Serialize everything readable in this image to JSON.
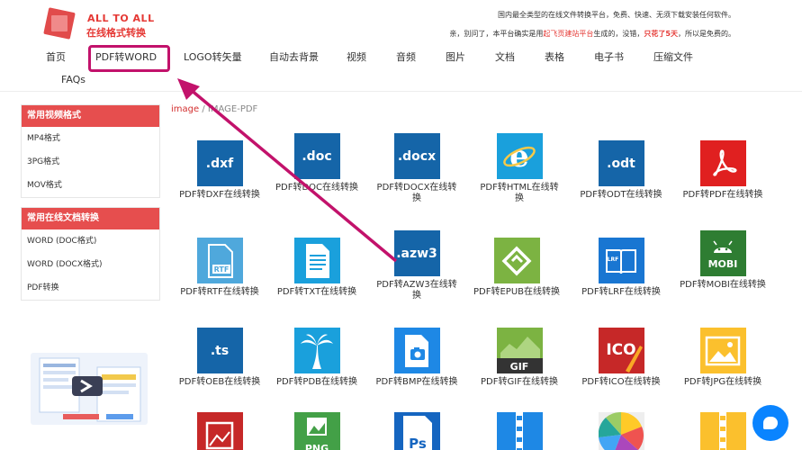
{
  "brand": {
    "line1": "ALL TO ALL",
    "line2": "在线格式转换"
  },
  "tagline": {
    "line1": "国内最全类型的在线文件转换平台，免费、快速、无须下载安装任何软件。",
    "line2_a": "亲，别问了，本平台确实是用",
    "line2_link": "起飞页建站平台",
    "line2_b": "生成的，没错，",
    "line2_bold": "只花了5天",
    "line2_c": "，所以是免费的。"
  },
  "nav": [
    "首页",
    "PDF转WORD",
    "LOGO转矢量",
    "自动去背景",
    "视频",
    "音频",
    "图片",
    "文档",
    "表格",
    "电子书",
    "压缩文件"
  ],
  "faq": "FAQs",
  "sidebar": {
    "groups": [
      {
        "title": "常用视频格式",
        "items": [
          "MP4格式",
          "3PG格式",
          "MOV格式"
        ]
      },
      {
        "title": "常用在线文档转换",
        "items": [
          "WORD (DOC格式)",
          "WORD (DOCX格式)",
          "PDF转换"
        ]
      }
    ]
  },
  "breadcrumb": {
    "link": "image",
    "sep": "/",
    "current": "IMAGE-PDF"
  },
  "tiles": [
    {
      "icon": "dxf-file-icon",
      "text": ".dxf",
      "label": "PDF转DXF在线转换"
    },
    {
      "icon": "doc-file-icon",
      "text": ".doc",
      "label": "PDF转DOC在线转换"
    },
    {
      "icon": "docx-file-icon",
      "text": ".docx",
      "label": "PDF转DOCX在线转换"
    },
    {
      "icon": "html-browser-icon",
      "text": "",
      "label": "PDF转HTML在线转换"
    },
    {
      "icon": "odt-file-icon",
      "text": ".odt",
      "label": "PDF转ODT在线转换"
    },
    {
      "icon": "pdf-acrobat-icon",
      "text": "",
      "label": "PDF转PDF在线转换"
    },
    {
      "icon": "rtf-file-icon",
      "text": "RTF",
      "label": "PDF转RTF在线转换"
    },
    {
      "icon": "txt-file-icon",
      "text": "",
      "label": "PDF转TXT在线转换"
    },
    {
      "icon": "azw3-file-icon",
      "text": ".azw3",
      "label": "PDF转AZW3在线转换"
    },
    {
      "icon": "epub-file-icon",
      "text": "",
      "label": "PDF转EPUB在线转换"
    },
    {
      "icon": "lrf-book-icon",
      "text": "LRF",
      "label": "PDF转LRF在线转换"
    },
    {
      "icon": "mobi-android-icon",
      "text": "MOBI",
      "label": "PDF转MOBI在线转换"
    },
    {
      "icon": "ts-file-icon",
      "text": ".ts",
      "label": "PDF转OEB在线转换"
    },
    {
      "icon": "palm-tree-icon",
      "text": "",
      "label": "PDF转PDB在线转换"
    },
    {
      "icon": "bmp-image-icon",
      "text": "",
      "label": "PDF转BMP在线转换"
    },
    {
      "icon": "gif-image-icon",
      "text": "GIF",
      "label": "PDF转GIF在线转换"
    },
    {
      "icon": "ico-image-icon",
      "text": "ICO",
      "label": "PDF转ICO在线转换"
    },
    {
      "icon": "jpg-image-icon",
      "text": "",
      "label": "PDF转JPG在线转换"
    },
    {
      "icon": "image-gallery-icon",
      "text": "",
      "label": ""
    },
    {
      "icon": "png-image-icon",
      "text": "PNG",
      "label": ""
    },
    {
      "icon": "photoshop-icon",
      "text": "Ps",
      "label": ""
    },
    {
      "icon": "zipper-icon",
      "text": "",
      "label": ""
    },
    {
      "icon": "color-wheel-icon",
      "text": "",
      "label": ""
    },
    {
      "icon": "zipper-icon",
      "text": "",
      "label": ""
    }
  ]
}
